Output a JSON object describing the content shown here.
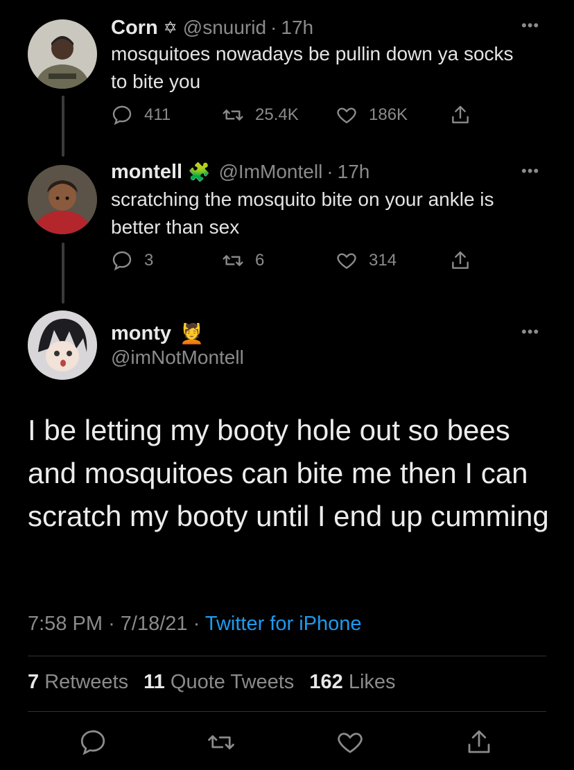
{
  "tweets": [
    {
      "name": "Corn",
      "name_badge": "✡",
      "handle": "@snuurid",
      "dot": "·",
      "time": "17h",
      "text": "mosquitoes nowadays be pullin down ya socks to bite you",
      "replies": "411",
      "retweets": "25.4K",
      "likes": "186K",
      "more": "•••"
    },
    {
      "name": "montell",
      "name_badge": "🧩",
      "handle": "@ImMontell",
      "dot": "·",
      "time": "17h",
      "text": "scratching the mosquito bite on your ankle is better than sex",
      "replies": "3",
      "retweets": "6",
      "likes": "314",
      "more": "•••"
    }
  ],
  "main_tweet": {
    "name": "monty",
    "name_emoji": "💆",
    "handle": "@imNotMontell",
    "more": "•••",
    "text": "I be letting my booty hole out so bees and mosquitoes can bite me then I can scratch my booty until I end up cumming",
    "time": "7:58 PM",
    "date": "7/18/21",
    "dot": "·",
    "source": "Twitter for iPhone",
    "retweets_count": "7",
    "retweets_label": "Retweets",
    "quotes_count": "11",
    "quotes_label": "Quote Tweets",
    "likes_count": "162",
    "likes_label": "Likes"
  },
  "colors": {
    "background": "#000000",
    "muted": "#8b8b8b",
    "link": "#1d9bf0"
  },
  "icons": [
    "reply-icon",
    "retweet-icon",
    "like-icon",
    "share-icon"
  ]
}
